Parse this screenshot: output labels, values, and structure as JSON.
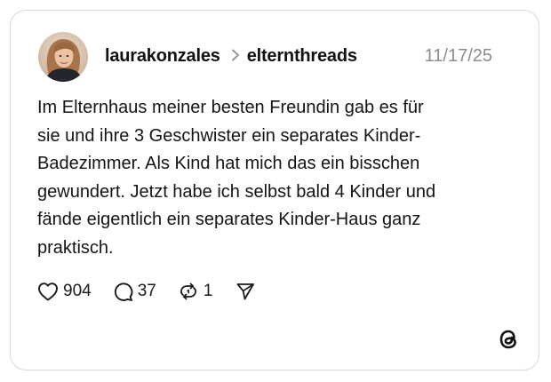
{
  "post": {
    "author": "laurakonzales",
    "separator": ">",
    "community": "elternthreads",
    "date": "11/17/25",
    "text": "Im Elternhaus meiner besten Freundin gab es für sie und ihre 3 Geschwister ein separates Kinder-Badezimmer. Als Kind hat mich das ein bisschen gewundert. Jetzt habe ich selbst bald 4 Kinder und fände eigentlich ein separates Kinder-Haus ganz praktisch.",
    "text_lines": [
      "Im Elternhaus meiner besten Freundin gab es für",
      "sie und ihre 3 Geschwister ein separates Kinder-",
      "Badezimmer. Als Kind hat mich das ein bisschen",
      "gewundert. Jetzt habe ich selbst bald 4 Kinder und",
      "fände eigentlich ein separates Kinder-Haus ganz",
      "praktisch."
    ]
  },
  "actions": {
    "likes": "904",
    "replies": "37",
    "reposts": "1"
  },
  "icons": {
    "like": "heart-icon",
    "reply": "comment-bubble-icon",
    "repost": "repost-icon",
    "share": "send-icon",
    "brand": "threads-logo-icon",
    "chevron": "chevron-right-icon"
  },
  "colors": {
    "text": "#111111",
    "muted": "#8c8c8c",
    "border": "#d9d9d9",
    "background": "#ffffff"
  }
}
